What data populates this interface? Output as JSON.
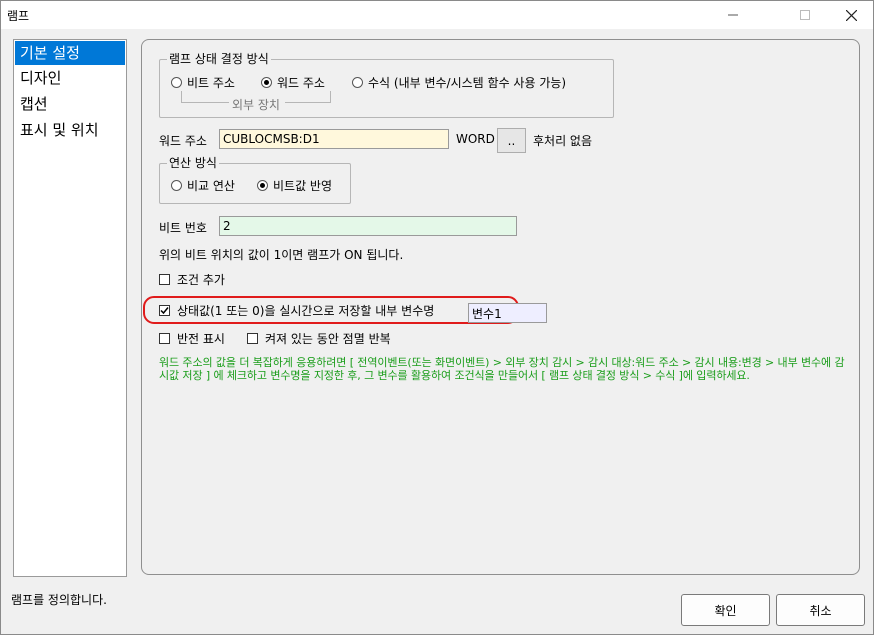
{
  "window": {
    "title": "램프"
  },
  "sidebar": {
    "items": [
      {
        "label": "기본 설정",
        "selected": true
      },
      {
        "label": "디자인",
        "selected": false
      },
      {
        "label": "캡션",
        "selected": false
      },
      {
        "label": "표시 및 위치",
        "selected": false
      }
    ]
  },
  "lamp_mode": {
    "group_label": "램프 상태 결정 방식",
    "options": [
      {
        "label": "비트 주소",
        "selected": false
      },
      {
        "label": "워드 주소",
        "selected": true
      },
      {
        "label": "수식 (내부 변수/시스템 함수 사용 가능)",
        "selected": false
      }
    ],
    "sub_label": "외부 장치"
  },
  "word_address": {
    "label": "워드 주소",
    "value": "CUBLOCMSB:D1",
    "unit": "WORD",
    "browse_label": "..",
    "post_process": "후처리 없음"
  },
  "operation": {
    "group_label": "연산 방식",
    "options": [
      {
        "label": "비교 연산",
        "selected": false
      },
      {
        "label": "비트값 반영",
        "selected": true
      }
    ]
  },
  "bit_number": {
    "label": "비트 번호",
    "value": "2"
  },
  "bit_note": "위의 비트 위치의 값이 1이면 램프가 ON 됩니다.",
  "add_condition": {
    "label": "조건 추가",
    "checked": false
  },
  "save_state": {
    "label": "상태값(1 또는 0)을 실시간으로 저장할 내부 변수명",
    "checked": true,
    "value": "변수1"
  },
  "invert_display": {
    "label": "반전 표시",
    "checked": false
  },
  "blink": {
    "label": "켜져 있는 동안 점멸 반복",
    "checked": false
  },
  "help_text": "워드 주소의 값을 더 복잡하게 응용하려면 [ 전역이벤트(또는 화면이벤트) > 외부 장치 감시 > 감시 대상:워드 주소 > 감시 내용:변경 > 내부 변수에 감시값 저장 ] 에 체크하고 변수명을 지정한 후, 그 변수를 활용하여 조건식을 만들어서 [ 램프 상태 결정 방식 > 수식 ]에 입력하세요.",
  "status": "램프를 정의합니다.",
  "buttons": {
    "ok": "확인",
    "cancel": "취소"
  },
  "colors": {
    "selection": "#0078d7",
    "word_field_bg": "#fff8dc",
    "bit_field_bg": "#e4f8e8",
    "var_field_bg": "#eeeeff",
    "highlight": "#e01b1b",
    "help_text": "#1a9d1a"
  },
  "icons": [
    "minimize-icon",
    "maximize-icon",
    "close-icon",
    "checkmark-icon"
  ]
}
